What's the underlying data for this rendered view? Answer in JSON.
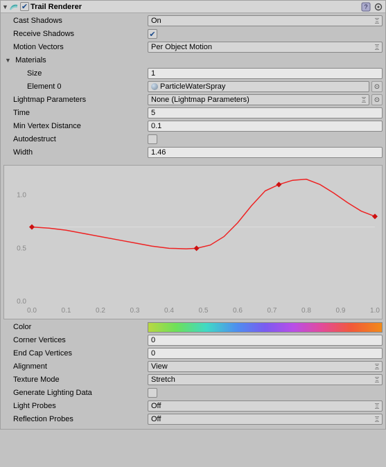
{
  "header": {
    "title": "Trail Renderer",
    "enabled": true
  },
  "props": {
    "castShadows": {
      "label": "Cast Shadows",
      "value": "On"
    },
    "receiveShadows": {
      "label": "Receive Shadows",
      "checked": true
    },
    "motionVectors": {
      "label": "Motion Vectors",
      "value": "Per Object Motion"
    },
    "materials": {
      "label": "Materials",
      "size": {
        "label": "Size",
        "value": "1"
      },
      "element0": {
        "label": "Element 0",
        "value": "ParticleWaterSpray"
      }
    },
    "lightmapParams": {
      "label": "Lightmap Parameters",
      "value": "None (Lightmap Parameters)"
    },
    "time": {
      "label": "Time",
      "value": "5"
    },
    "minVertexDistance": {
      "label": "Min Vertex Distance",
      "value": "0.1"
    },
    "autodestruct": {
      "label": "Autodestruct",
      "checked": false
    },
    "width": {
      "label": "Width",
      "value": "1.46"
    },
    "color": {
      "label": "Color"
    },
    "cornerVertices": {
      "label": "Corner Vertices",
      "value": "0"
    },
    "endCapVertices": {
      "label": "End Cap Vertices",
      "value": "0"
    },
    "alignment": {
      "label": "Alignment",
      "value": "View"
    },
    "textureMode": {
      "label": "Texture Mode",
      "value": "Stretch"
    },
    "generateLightingData": {
      "label": "Generate Lighting Data",
      "checked": false
    },
    "lightProbes": {
      "label": "Light Probes",
      "value": "Off"
    },
    "reflectionProbes": {
      "label": "Reflection Probes",
      "value": "Off"
    }
  },
  "chart_data": {
    "type": "line",
    "title": "",
    "xlabel": "",
    "ylabel": "",
    "xlim": [
      0.0,
      1.0
    ],
    "ylim": [
      0.0,
      1.2
    ],
    "x_ticks": [
      0.0,
      0.1,
      0.2,
      0.3,
      0.4,
      0.5,
      0.6,
      0.7,
      0.8,
      0.9,
      1.0
    ],
    "y_ticks": [
      0.0,
      0.5,
      1.0
    ],
    "keys": [
      {
        "x": 0.0,
        "y": 0.7
      },
      {
        "x": 0.48,
        "y": 0.5
      },
      {
        "x": 0.72,
        "y": 1.1
      },
      {
        "x": 1.0,
        "y": 0.8
      }
    ],
    "curve_samples": [
      {
        "x": 0.0,
        "y": 0.7
      },
      {
        "x": 0.05,
        "y": 0.69
      },
      {
        "x": 0.1,
        "y": 0.67
      },
      {
        "x": 0.15,
        "y": 0.64
      },
      {
        "x": 0.2,
        "y": 0.61
      },
      {
        "x": 0.25,
        "y": 0.58
      },
      {
        "x": 0.3,
        "y": 0.55
      },
      {
        "x": 0.35,
        "y": 0.52
      },
      {
        "x": 0.4,
        "y": 0.5
      },
      {
        "x": 0.45,
        "y": 0.495
      },
      {
        "x": 0.48,
        "y": 0.5
      },
      {
        "x": 0.52,
        "y": 0.53
      },
      {
        "x": 0.56,
        "y": 0.61
      },
      {
        "x": 0.6,
        "y": 0.74
      },
      {
        "x": 0.64,
        "y": 0.9
      },
      {
        "x": 0.68,
        "y": 1.04
      },
      {
        "x": 0.72,
        "y": 1.1
      },
      {
        "x": 0.76,
        "y": 1.14
      },
      {
        "x": 0.8,
        "y": 1.15
      },
      {
        "x": 0.84,
        "y": 1.1
      },
      {
        "x": 0.88,
        "y": 1.02
      },
      {
        "x": 0.92,
        "y": 0.93
      },
      {
        "x": 0.96,
        "y": 0.85
      },
      {
        "x": 1.0,
        "y": 0.8
      }
    ]
  }
}
